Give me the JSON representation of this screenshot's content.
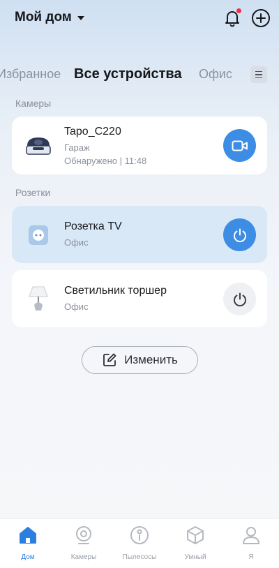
{
  "header": {
    "home_title": "Мой дом",
    "has_notification_dot": true,
    "accent_color": "#3c8de3"
  },
  "tabs": {
    "favorites": "Избранное",
    "all_devices": "Все устройства",
    "office": "Офис",
    "active": "all_devices"
  },
  "sections": {
    "cameras_label": "Камеры",
    "sockets_label": "Розетки"
  },
  "devices": [
    {
      "name": "Tapo_C220",
      "room": "Гараж",
      "status": "Обнаружено | 11:48",
      "icon": "camera-device-icon",
      "action_icon": "video-camera-icon",
      "active": false
    },
    {
      "name": "Розетка TV",
      "room": "Офис",
      "icon": "smart-plug-icon",
      "action_icon": "power-icon",
      "power_on": true
    },
    {
      "name": "Светильник торшер",
      "room": "Офис",
      "icon": "floor-lamp-icon",
      "action_icon": "power-icon",
      "power_on": false
    }
  ],
  "edit_button": {
    "label": "Изменить",
    "icon": "edit-icon"
  },
  "bottom_nav": {
    "items": [
      {
        "label": "Дом",
        "icon": "home-icon",
        "active": true
      },
      {
        "label": "Камеры",
        "icon": "camera-icon",
        "active": false
      },
      {
        "label": "Пылесосы",
        "icon": "vacuum-icon",
        "active": false
      },
      {
        "label": "Умный",
        "icon": "cube-icon",
        "active": false
      },
      {
        "label": "Я",
        "icon": "person-icon",
        "active": false
      }
    ]
  }
}
